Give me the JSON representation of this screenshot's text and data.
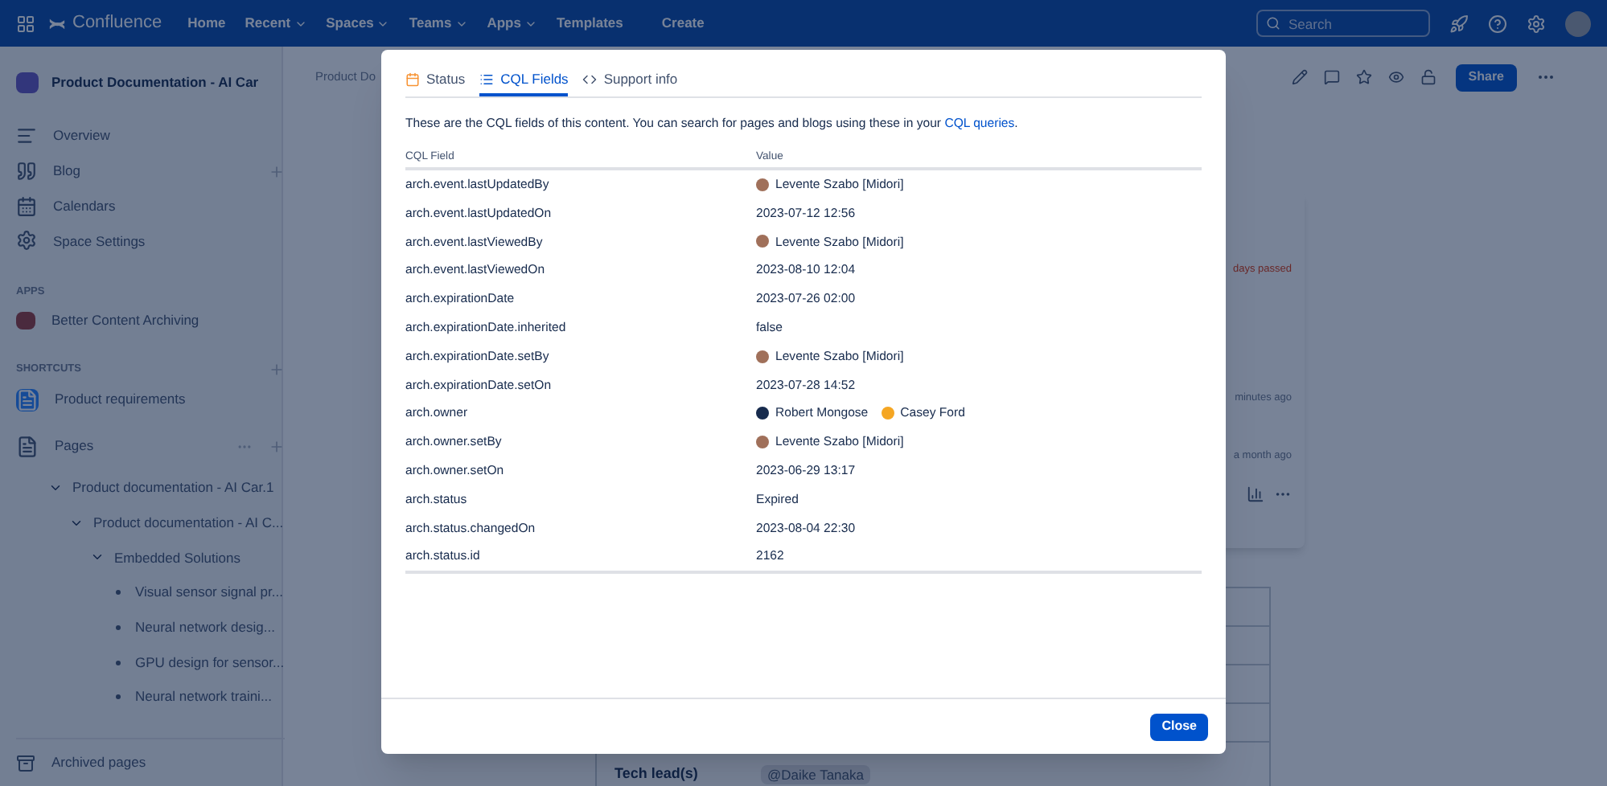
{
  "topnav": {
    "product": "Confluence",
    "items": [
      {
        "label": "Home",
        "dropdown": false
      },
      {
        "label": "Recent",
        "dropdown": true
      },
      {
        "label": "Spaces",
        "dropdown": true
      },
      {
        "label": "Teams",
        "dropdown": true
      },
      {
        "label": "Apps",
        "dropdown": true
      },
      {
        "label": "Templates",
        "dropdown": false
      }
    ],
    "create": "Create",
    "search": {
      "placeholder": "Search"
    }
  },
  "sidebar": {
    "space_title": "Product Documentation - AI Car",
    "items": [
      {
        "kind": "overview",
        "label": "Overview",
        "addable": false
      },
      {
        "kind": "blog",
        "label": "Blog",
        "addable": true
      },
      {
        "kind": "calendar",
        "label": "Calendars",
        "addable": false
      },
      {
        "kind": "settings",
        "label": "Space Settings",
        "addable": false
      }
    ],
    "apps": {
      "title": "APPS",
      "items": [
        "Better Content Archiving"
      ]
    },
    "shortcuts": {
      "title": "SHORTCUTS",
      "items": [
        "Product requirements"
      ]
    },
    "pages": {
      "title": "Pages",
      "tree": [
        {
          "label": "Product documentation - AI Car.1",
          "expanded": true,
          "children": [
            {
              "label": "Product documentation - AI C...",
              "expanded": true,
              "children": [
                {
                  "label": "Embedded Solutions",
                  "expanded": true,
                  "children": [
                    {
                      "label": "Visual sensor signal pr..."
                    },
                    {
                      "label": "Neural network desig..."
                    },
                    {
                      "label": "GPU design for sensor..."
                    },
                    {
                      "label": "Neural network traini..."
                    }
                  ]
                }
              ]
            }
          ]
        }
      ]
    },
    "archived": "Archived pages"
  },
  "page": {
    "breadcrumb": "Product Do",
    "share": "Share",
    "card_lines": [
      "days passed",
      "minutes ago",
      "a month ago"
    ],
    "table_label": "Tech lead(s)",
    "table_value": "@Daike Tanaka"
  },
  "dialog": {
    "tabs": [
      {
        "label": "Status",
        "kind": "status",
        "selected": false
      },
      {
        "label": "CQL Fields",
        "kind": "list",
        "selected": true
      },
      {
        "label": "Support info",
        "kind": "code",
        "selected": false
      }
    ],
    "description": "These are the CQL fields of this content. You can search for pages and blogs using these in your ",
    "link": "CQL queries",
    "after_link": ".",
    "columns": [
      "CQL Field",
      "Value"
    ],
    "rows": [
      {
        "field": "arch.event.lastUpdatedBy",
        "kind": "users",
        "users": [
          {
            "name": "Levente Szabo [Midori]",
            "color": "#a0705a"
          }
        ]
      },
      {
        "field": "arch.event.lastUpdatedOn",
        "kind": "text",
        "value": "2023-07-12 12:56"
      },
      {
        "field": "arch.event.lastViewedBy",
        "kind": "users",
        "users": [
          {
            "name": "Levente Szabo [Midori]",
            "color": "#a0705a"
          }
        ]
      },
      {
        "field": "arch.event.lastViewedOn",
        "kind": "text",
        "value": "2023-08-10 12:04"
      },
      {
        "field": "arch.expirationDate",
        "kind": "text",
        "value": "2023-07-26 02:00"
      },
      {
        "field": "arch.expirationDate.inherited",
        "kind": "text",
        "value": "false"
      },
      {
        "field": "arch.expirationDate.setBy",
        "kind": "users",
        "users": [
          {
            "name": "Levente Szabo [Midori]",
            "color": "#a0705a"
          }
        ]
      },
      {
        "field": "arch.expirationDate.setOn",
        "kind": "text",
        "value": "2023-07-28 14:52"
      },
      {
        "field": "arch.owner",
        "kind": "users",
        "users": [
          {
            "name": "Robert Mongose",
            "color": "#172b4d"
          },
          {
            "name": "Casey Ford",
            "color": "#f5a623"
          }
        ]
      },
      {
        "field": "arch.owner.setBy",
        "kind": "users",
        "users": [
          {
            "name": "Levente Szabo [Midori]",
            "color": "#a0705a"
          }
        ]
      },
      {
        "field": "arch.owner.setOn",
        "kind": "text",
        "value": "2023-06-29 13:17"
      },
      {
        "field": "arch.status",
        "kind": "text",
        "value": "Expired"
      },
      {
        "field": "arch.status.changedOn",
        "kind": "text",
        "value": "2023-08-04 22:30"
      },
      {
        "field": "arch.status.id",
        "kind": "text",
        "value": "2162"
      }
    ],
    "close": "Close"
  }
}
